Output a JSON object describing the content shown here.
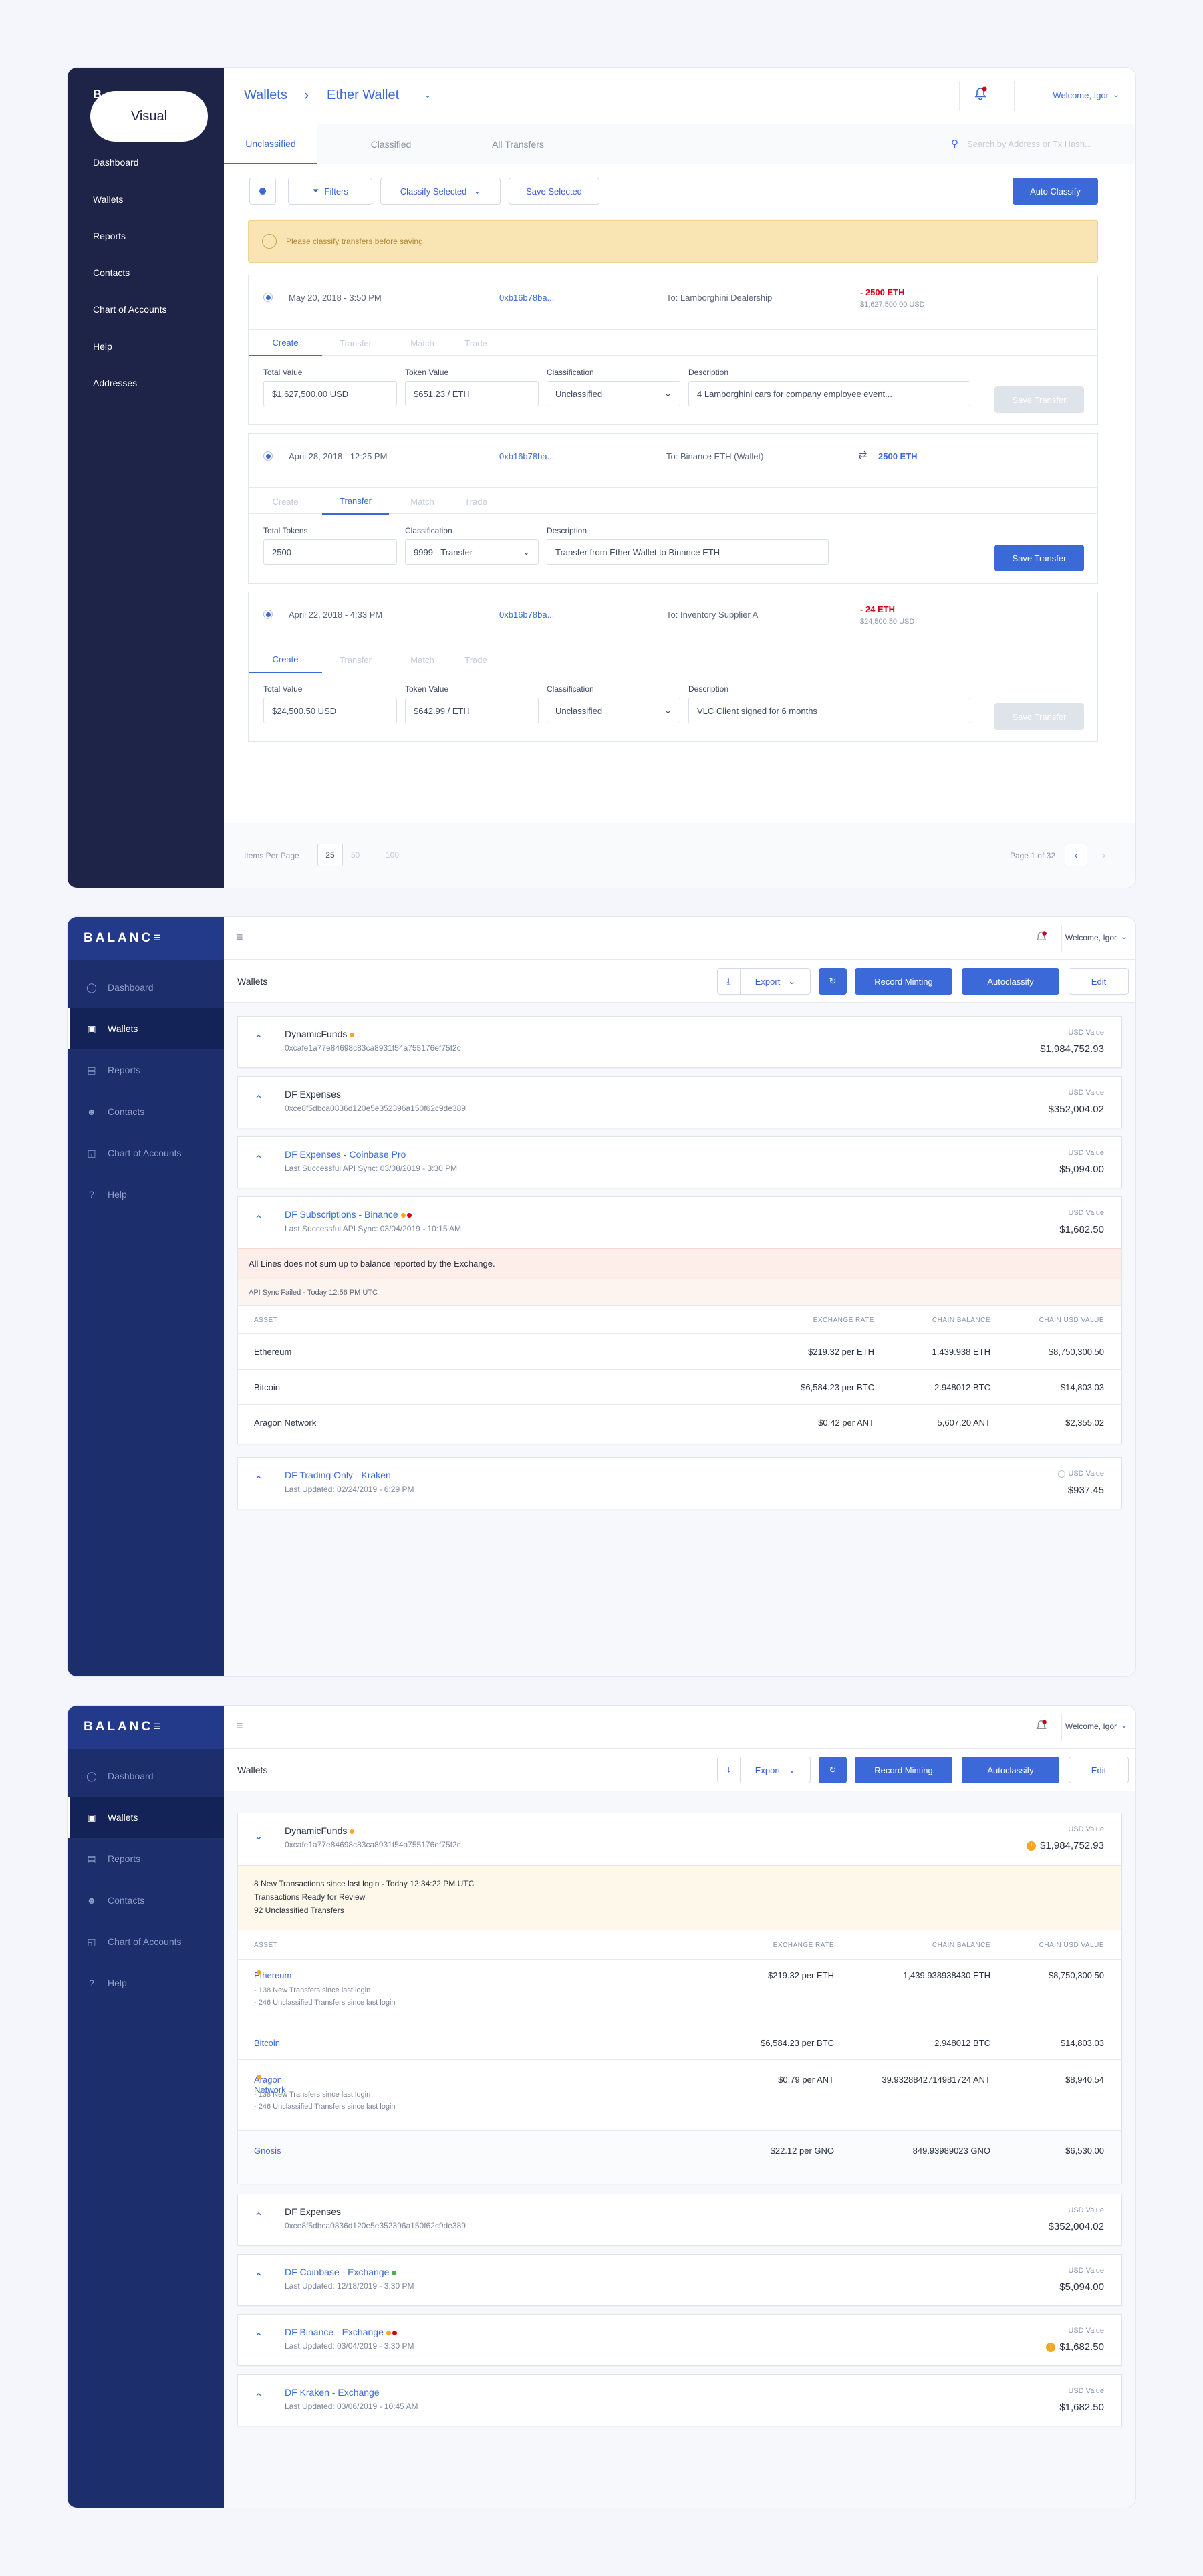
{
  "frame1": {
    "sidebar": {
      "brand": "B",
      "items": [
        "Dashboard",
        "Wallets",
        "Reports",
        "Contacts",
        "Chart of Accounts",
        "Help",
        "Addresses"
      ]
    },
    "tooltip": "Visual",
    "header": {
      "crumb1": "Wallets",
      "crumb_sep": "›",
      "crumb2": "Ether Wallet",
      "welcome": "Welcome, Igor"
    },
    "tabs": [
      "Unclassified",
      "Classified",
      "All Transfers"
    ],
    "search_placeholder": "Search by Address or Tx Hash...",
    "toolbar": {
      "filters": "Filters",
      "classify": "Classify Selected",
      "save": "Save Selected",
      "auto": "Auto Classify"
    },
    "warning": "Please classify transfers before saving.",
    "subtabs": [
      "Create",
      "Transfer",
      "Match",
      "Trade"
    ],
    "tx": [
      {
        "date": "May 20, 2018 - 3:50 PM",
        "hash": "0xb16b78ba...",
        "to": "To: Lamborghini Dealership",
        "amount": "- 2500 ETH",
        "usd": "$1,627,500.00 USD",
        "labels": [
          "Total Value",
          "Token Value",
          "Classification",
          "Description"
        ],
        "values": [
          "$1,627,500.00 USD",
          "$651.23 / ETH",
          "Unclassified",
          "4 Lamborghini cars for company employee event..."
        ],
        "save": "Save Transfer"
      },
      {
        "date": "April 28, 2018 - 12:25 PM",
        "hash": "0xb16b78ba...",
        "to": "To: Binance ETH (Wallet)",
        "amount": "2500 ETH",
        "labels": [
          "Total Tokens",
          "Classification",
          "Description"
        ],
        "values": [
          "2500",
          "9999 - Transfer",
          "Transfer from Ether Wallet to Binance ETH"
        ],
        "save": "Save Transfer"
      },
      {
        "date": "April 22, 2018 - 4:33 PM",
        "hash": "0xb16b78ba...",
        "to": "To: Inventory Supplier A",
        "amount": "- 24 ETH",
        "usd": "$24,500.50 USD",
        "labels": [
          "Total Value",
          "Token Value",
          "Classification",
          "Description"
        ],
        "values": [
          "$24,500.50 USD",
          "$642.99 / ETH",
          "Unclassified",
          "VLC Client signed for 6 months"
        ],
        "save": "Save Transfer"
      }
    ],
    "footer": {
      "items_per_page": "Items Per Page",
      "sizes": [
        "25",
        "50",
        "100"
      ],
      "page": "Page 1 of 32"
    }
  },
  "app": {
    "brand": "BALANC≡",
    "nav": [
      "Dashboard",
      "Wallets",
      "Reports",
      "Contacts",
      "Chart of Accounts",
      "Help"
    ],
    "welcome": "Welcome, Igor",
    "title": "Wallets",
    "export": "Export",
    "record": "Record Minting",
    "autoclassify": "Autoclassify",
    "edit": "Edit",
    "usd_label": "USD Value",
    "cols": {
      "asset": "ASSET",
      "rate": "EXCHANGE RATE",
      "bal": "CHAIN BALANCE",
      "usd": "CHAIN USD VALUE"
    }
  },
  "frame2": {
    "wallets": [
      {
        "name": "DynamicFunds",
        "sub": "0xcafe1a77e84698c83ca8931f54a755176ef75f2c",
        "usd": "$1,984,752.93"
      },
      {
        "name": "DF Expenses",
        "sub": "0xce8f5dbca0836d120e5e352396a150f62c9de389",
        "usd": "$352,004.02"
      },
      {
        "name": "DF Expenses - Coinbase Pro",
        "sub": "Last Successful API Sync: 03/08/2019 - 3:30 PM",
        "usd": "$5,094.00"
      },
      {
        "name": "DF Subscriptions - Binance",
        "sub": "Last Successful API Sync: 03/04/2019 - 10:15 AM",
        "usd": "$1,682.50"
      },
      {
        "name": "DF Trading Only - Kraken",
        "sub": "Last Updated: 02/24/2019 - 6:29 PM",
        "usd": "$937.45"
      }
    ],
    "alert1": "All Lines does not sum up to balance reported by the Exchange.",
    "alert2": "API Sync Failed - Today 12:56 PM UTC",
    "rows": [
      {
        "asset": "Ethereum",
        "rate": "$219.32 per ETH",
        "bal": "1,439.938 ETH",
        "usd": "$8,750,300.50"
      },
      {
        "asset": "Bitcoin",
        "rate": "$6,584.23 per BTC",
        "bal": "2.948012 BTC",
        "usd": "$14,803.03"
      },
      {
        "asset": "Aragon Network",
        "rate": "$0.42 per ANT",
        "bal": "5,607.20 ANT",
        "usd": "$2,355.02"
      }
    ]
  },
  "frame3": {
    "first": {
      "name": "DynamicFunds",
      "sub": "0xcafe1a77e84698c83ca8931f54a755176ef75f2c",
      "usd": "$1,984,752.93"
    },
    "notice": [
      "8 New Transactions since last login - Today 12:34:22 PM UTC",
      "Transactions Ready for Review",
      "92 Unclassified Transfers"
    ],
    "rows": [
      {
        "asset": "Ethereum",
        "rate": "$219.32 per ETH",
        "bal": "1,439.938938430 ETH",
        "usd": "$8,750,300.50",
        "n1": "- 138 New Transfers since last login",
        "n2": "- 246 Unclassified Transfers since last login"
      },
      {
        "asset": "Bitcoin",
        "rate": "$6,584.23 per BTC",
        "bal": "2.948012 BTC",
        "usd": "$14,803.03"
      },
      {
        "asset": "Aragon Network",
        "rate": "$0.79 per ANT",
        "bal": "39.9328842714981724 ANT",
        "usd": "$8,940.54",
        "n1": "- 138 New Transfers since last login",
        "n2": "- 246 Unclassified Transfers since last login"
      },
      {
        "asset": "Gnosis",
        "rate": "$22.12 per GNO",
        "bal": "849.93989023 GNO",
        "usd": "$6,530.00"
      }
    ],
    "wallets": [
      {
        "name": "DF Expenses",
        "sub": "0xce8f5dbca0836d120e5e352396a150f62c9de389",
        "usd": "$352,004.02"
      },
      {
        "name": "DF Coinbase - Exchange",
        "sub": "Last Updated: 12/18/2019 - 3:30 PM",
        "usd": "$5,094.00"
      },
      {
        "name": "DF Binance - Exchange",
        "sub": "Last Updated: 03/04/2019 - 3:30 PM",
        "usd": "$1,682.50"
      },
      {
        "name": "DF Kraken - Exchange",
        "sub": "Last Updated: 03/06/2019 - 10:45 AM",
        "usd": "$1,682.50"
      }
    ]
  }
}
